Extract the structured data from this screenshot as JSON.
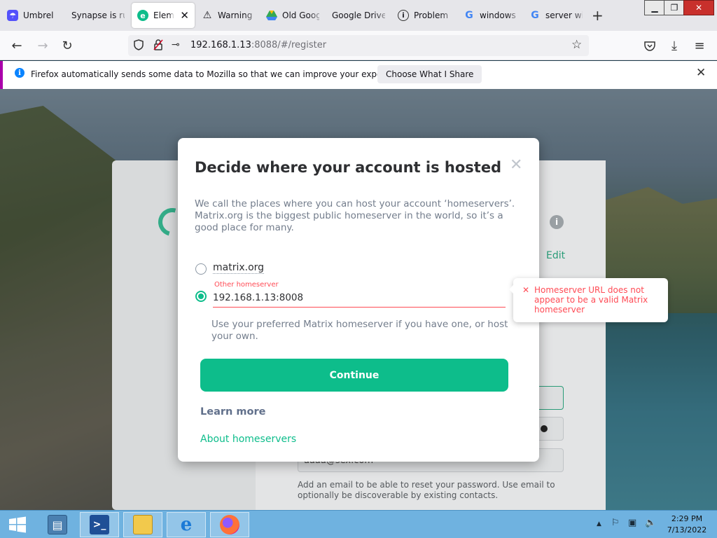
{
  "browser": {
    "tabs": [
      {
        "label": "Umbrel",
        "icon": "umbrel-icon",
        "active": false
      },
      {
        "label": "Synapse is running",
        "icon": "none",
        "active": false
      },
      {
        "label": "Element",
        "icon": "element-icon",
        "active": true
      },
      {
        "label": "Warning",
        "icon": "warning-icon",
        "active": false
      },
      {
        "label": "Old Google",
        "icon": "google-drive-icon",
        "active": false
      },
      {
        "label": "Google Drive",
        "icon": "none",
        "active": false
      },
      {
        "label": "Problem",
        "icon": "info-icon",
        "active": false
      },
      {
        "label": "windows",
        "icon": "google-icon",
        "active": false
      },
      {
        "label": "server win",
        "icon": "google-icon",
        "active": false
      }
    ],
    "new_tab": "+",
    "url_host": "192.168.1.13",
    "url_path": ":8088/#/register"
  },
  "notification": {
    "text": "Firefox automatically sends some data to Mozilla so that we can improve your experience.",
    "button": "Choose What I Share"
  },
  "background": {
    "edit_label": "Edit",
    "email_value": "aaaa@sex.com",
    "email_help": "Add an email to be able to reset your password. Use email to optionally be discoverable by existing contacts."
  },
  "dialog": {
    "title": "Decide where your account is hosted",
    "description": "We call the places where you can host your account ‘homeservers’. Matrix.org is the biggest public homeserver in the world, so it’s a good place for many.",
    "option_matrix": "matrix.org",
    "other_label": "Other homeserver",
    "other_value": "192.168.1.13:8008",
    "other_description": "Use your preferred Matrix homeserver if you have one, or host your own.",
    "continue": "Continue",
    "learn_more": "Learn more",
    "about": "About homeservers"
  },
  "error_tooltip": {
    "text": "Homeserver URL does not appear to be a valid Matrix homeserver"
  },
  "taskbar": {
    "time": "2:29 PM",
    "date": "7/13/2022"
  },
  "colors": {
    "accent": "#0dbd8b",
    "error": "#ff4b55",
    "taskbar": "#6fb2e0"
  }
}
